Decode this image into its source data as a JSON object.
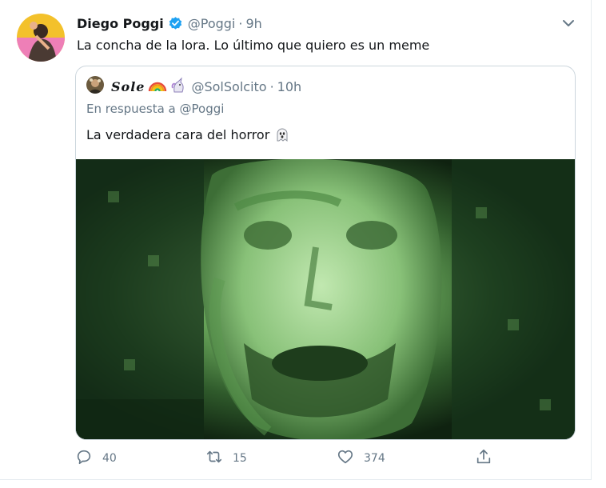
{
  "tweet": {
    "display_name": "Diego Poggi",
    "handle": "@Poggi",
    "separator": "·",
    "time": "9h",
    "text": "La concha de la lora. Lo último que quiero es un meme",
    "replies": "40",
    "retweets": "15",
    "likes": "374"
  },
  "quoted": {
    "display_name": "𝑺𝒐𝒍𝒆",
    "handle": "@SolSolcito",
    "separator": "·",
    "time": "10h",
    "reply_prefix": "En respuesta a",
    "reply_to": "@Poggi",
    "text": "La verdadera cara del horror"
  },
  "icons": {
    "verified": "verified-badge-icon",
    "caret": "chevron-down-icon",
    "reply": "reply-icon",
    "retweet": "retweet-icon",
    "like": "heart-icon",
    "share": "share-icon",
    "rainbow": "rainbow-emoji",
    "unicorn": "unicorn-emoji",
    "ghost": "ghost-emoji"
  },
  "colors": {
    "verified": "#1da1f2",
    "text_primary": "#14171a",
    "text_secondary": "#657786",
    "border": "#ccd6dd"
  }
}
